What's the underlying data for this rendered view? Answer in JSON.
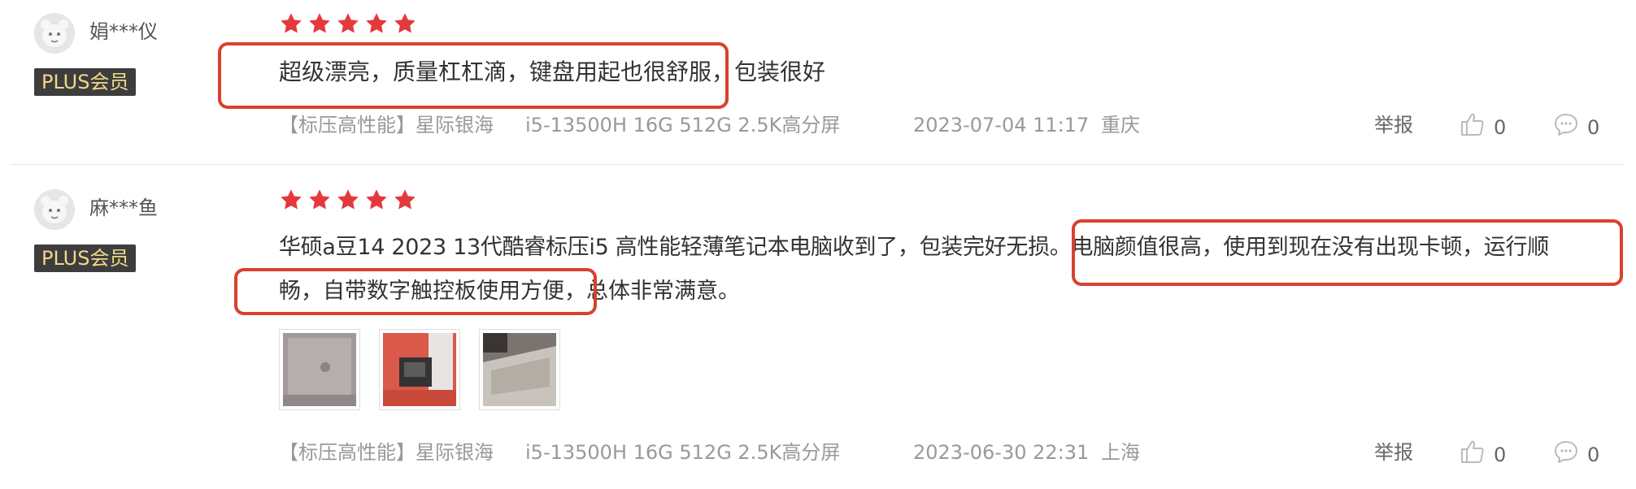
{
  "colors": {
    "accent": "#d9412e",
    "star": "#e4393c",
    "badge_bg": "#3d3d3d",
    "badge_text": "#f0d88a"
  },
  "reviews": [
    {
      "username": "娟***仪",
      "badge": "PLUS会员",
      "rating": 5,
      "content_line1": "超级漂亮，质量杠杠滴，键盘用起也很舒服，包装很好",
      "variant_type": "【标压高性能】星际银海",
      "variant_spec": "i5-13500H 16G 512G 2.5K高分屏",
      "datetime": "2023-07-04 11:17",
      "location": "重庆",
      "report_label": "举报",
      "likes": "0",
      "comments": "0"
    },
    {
      "username": "麻***鱼",
      "badge": "PLUS会员",
      "rating": 5,
      "content_line1": "华硕a豆14 2023 13代酷睿标压i5 高性能轻薄笔记本电脑收到了，包装完好无损。电脑颜值很高，使用到现在没有出现卡顿，运行顺",
      "content_line2": "畅，自带数字触控板使用方便，总体非常满意。",
      "images": [
        "laptop-lid-photo",
        "laptop-box-photo",
        "laptop-keyboard-photo"
      ],
      "variant_type": "【标压高性能】星际银海",
      "variant_spec": "i5-13500H 16G 512G 2.5K高分屏",
      "datetime": "2023-06-30 22:31",
      "location": "上海",
      "report_label": "举报",
      "likes": "0",
      "comments": "0"
    }
  ]
}
